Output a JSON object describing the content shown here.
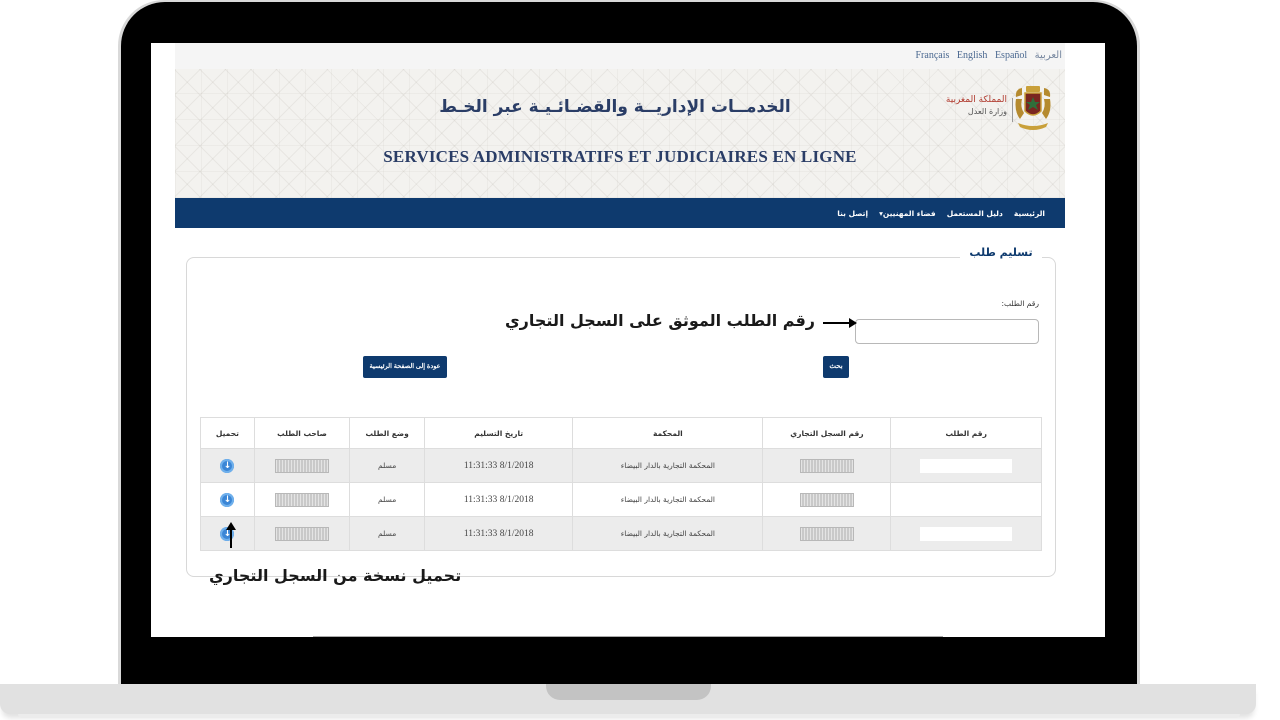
{
  "languages": [
    "Français",
    "English",
    "Español",
    "العربية"
  ],
  "header": {
    "title_ar": "الخدمــات الإداريــة والقضـائـيـة عبر الخـط",
    "title_fr": "SERVICES ADMINISTRATIFS ET JUDICIAIRES EN LIGNE",
    "kingdom": "المملكة المغربية",
    "ministry": "وزارة العدل"
  },
  "nav": [
    "الرئيسية",
    "دليل المستعمل",
    "فضاء المهنيين▾",
    "إتصل بنا"
  ],
  "form": {
    "legend": "تسليم طلب",
    "request_label": "رقم الطلب:",
    "request_value": "",
    "search_button": "بحث",
    "back_button": "عودة إلى الصفحة الرئيسية"
  },
  "annotations": {
    "input_note": "رقم الطلب الموثق على السجل التجاري",
    "download_note": "تحميل نسخة من السجل التجاري"
  },
  "table": {
    "headers": [
      "رقم الطلب",
      "رقم السجل التجاري",
      "المحكمة",
      "تاريخ التسليم",
      "وضع الطلب",
      "صاحب الطلب",
      "تحميل"
    ],
    "rows": [
      {
        "court": "المحكمة التجارية بالدار البيضاء",
        "date": "8/1/2018 11:31:33",
        "status": "مسلم"
      },
      {
        "court": "المحكمة التجارية بالدار البيضاء",
        "date": "8/1/2018 11:31:33",
        "status": "مسلم"
      },
      {
        "court": "المحكمة التجارية بالدار البيضاء",
        "date": "8/1/2018 11:31:33",
        "status": "مسلم"
      }
    ]
  },
  "colors": {
    "navbar": "#0e3a6e",
    "title": "#2a3d66",
    "download_icon": "#3b86d6",
    "kingdom_text": "#b03a2e"
  }
}
